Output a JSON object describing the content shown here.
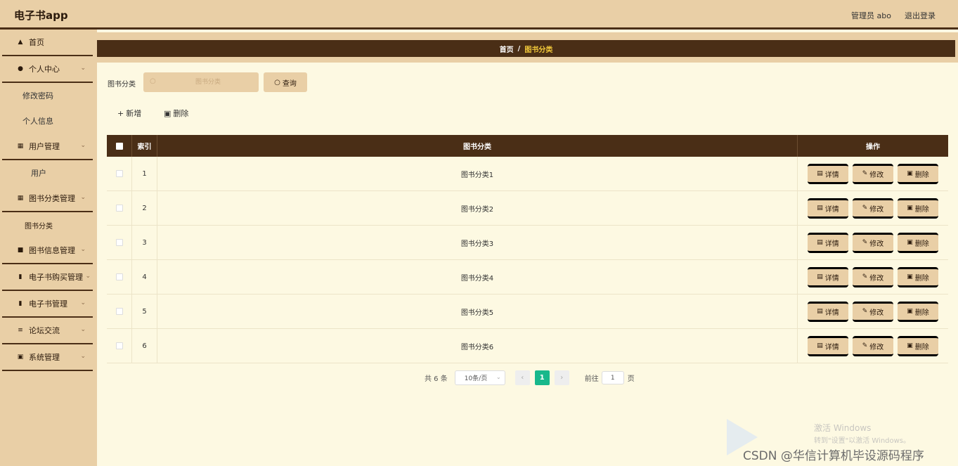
{
  "header": {
    "app_title": "电子书app",
    "user": "管理员 abo",
    "logout": "退出登录"
  },
  "sidebar": {
    "home": "首页",
    "personal": "个人中心",
    "personal_sub": [
      "修改密码",
      "个人信息"
    ],
    "user_mgmt": "用户管理",
    "user_sub": [
      "用户"
    ],
    "category_mgmt": "图书分类管理",
    "category_sub": [
      "图书分类"
    ],
    "book_info": "图书信息管理",
    "purchase": "电子书购买管理",
    "ebook": "电子书管理",
    "forum": "论坛交流",
    "system": "系统管理"
  },
  "breadcrumb": {
    "home": "首页",
    "sep": "/",
    "current": "图书分类"
  },
  "search": {
    "label": "图书分类",
    "placeholder": "图书分类",
    "value": "",
    "button": "查询"
  },
  "toolbar": {
    "add": "新增",
    "delete": "删除"
  },
  "table": {
    "columns": {
      "index": "索引",
      "name": "图书分类",
      "ops": "操作"
    },
    "rows": [
      {
        "index": "1",
        "name": "图书分类1"
      },
      {
        "index": "2",
        "name": "图书分类2"
      },
      {
        "index": "3",
        "name": "图书分类3"
      },
      {
        "index": "4",
        "name": "图书分类4"
      },
      {
        "index": "5",
        "name": "图书分类5"
      },
      {
        "index": "6",
        "name": "图书分类6"
      }
    ],
    "row_actions": {
      "detail": "详情",
      "edit": "修改",
      "delete": "删除"
    }
  },
  "pagination": {
    "total": "共 6 条",
    "page_size": "10条/页",
    "current_page": "1",
    "goto_label": "前往",
    "goto_value": "1",
    "page_suffix": "页"
  },
  "watermark": {
    "line1": "激活 Windows",
    "line2": "转到\"设置\"以激活 Windows。",
    "csdn": "CSDN @华信计算机毕设源码程序"
  },
  "colors": {
    "header_bg": "#e9cfa6",
    "dark_brown": "#4a2e16",
    "content_bg": "#fdf9e2",
    "breadcrumb_current": "#f2c93a",
    "pager_active": "#18b88b"
  },
  "icons": {
    "home": "home-icon",
    "user": "user-icon",
    "grid": "grid-icon",
    "bag": "bag-icon",
    "doc": "document-icon",
    "book": "book-icon",
    "forum": "forum-icon",
    "system": "system-icon"
  }
}
